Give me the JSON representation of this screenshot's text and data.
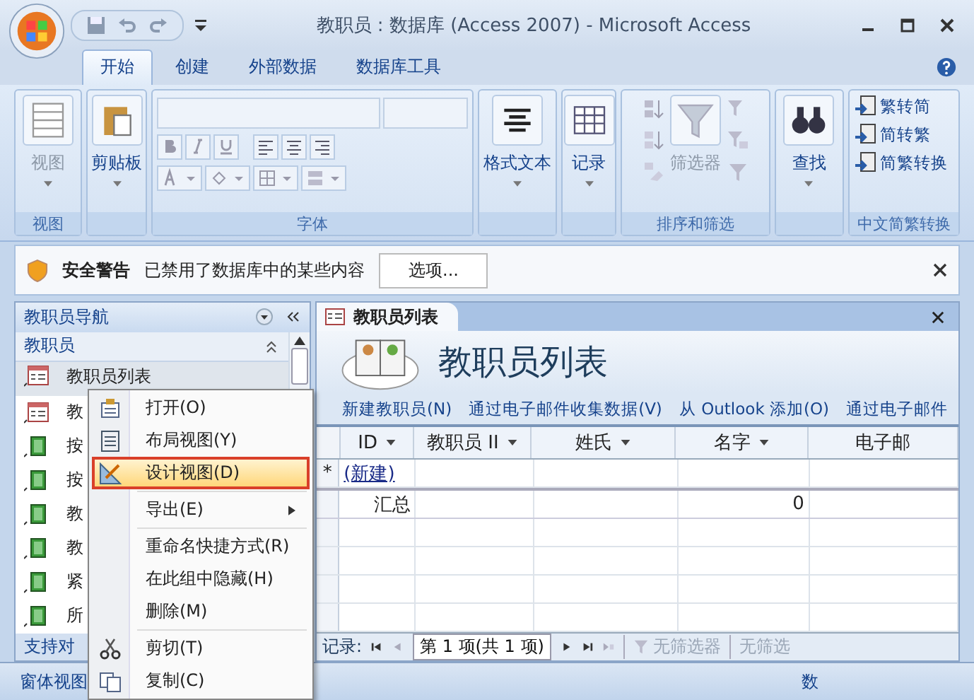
{
  "window": {
    "title": "教职员 : 数据库 (Access 2007) - Microsoft Access"
  },
  "ribbon_tabs": [
    {
      "label": "开始",
      "selected": true
    },
    {
      "label": "创建",
      "selected": false
    },
    {
      "label": "外部数据",
      "selected": false
    },
    {
      "label": "数据库工具",
      "selected": false
    }
  ],
  "ribbon_groups": [
    {
      "kind": "large",
      "button": "视图",
      "disabled": true,
      "footer": "视图"
    },
    {
      "kind": "large",
      "button": "剪贴板",
      "disabled": false
    },
    {
      "kind": "font",
      "footer": "字体"
    },
    {
      "kind": "large",
      "button": "格式文本",
      "disabled": false
    },
    {
      "kind": "large",
      "button": "记录",
      "disabled": false
    },
    {
      "kind": "sort",
      "button": "筛选器",
      "disabled": true,
      "footer": "排序和筛选"
    },
    {
      "kind": "large",
      "button": "查找",
      "disabled": false
    },
    {
      "kind": "list",
      "items": [
        "繁转简",
        "简转繁",
        "简繁转换"
      ],
      "footer": "中文简繁转换"
    }
  ],
  "security_bar": {
    "title": "安全警告",
    "message": "已禁用了数据库中的某些内容",
    "button": "选项..."
  },
  "nav_pane": {
    "title": "教职员导航",
    "group": "教职员",
    "items": [
      {
        "label": "教职员列表",
        "kind": "form-list",
        "selected": true
      },
      {
        "label": "教",
        "kind": "form-list",
        "selected": false
      },
      {
        "label": "按",
        "kind": "report",
        "selected": false
      },
      {
        "label": "按",
        "kind": "report",
        "selected": false
      },
      {
        "label": "教",
        "kind": "report",
        "selected": false
      },
      {
        "label": "教",
        "kind": "report",
        "selected": false
      },
      {
        "label": "紧",
        "kind": "report",
        "selected": false
      },
      {
        "label": "所",
        "kind": "report",
        "selected": false
      }
    ],
    "footer": "支持对"
  },
  "document": {
    "tab": "教职员列表",
    "header": "教职员列表",
    "actions": [
      "新建教职员(N)",
      "通过电子邮件收集数据(V)",
      "从 Outlook 添加(O)",
      "通过电子邮件"
    ],
    "columns": [
      "ID",
      "教职员 II",
      "姓氏",
      "名字",
      "电子邮"
    ],
    "new_row": {
      "marker": "*",
      "label": "(新建)"
    },
    "total_row": {
      "label": "汇总",
      "cells": [
        "",
        "",
        "0",
        ""
      ]
    },
    "record_nav": {
      "label": "记录:",
      "position": "第 1 项(共 1 项)",
      "filter": "无筛选器",
      "search": "无筛选"
    }
  },
  "context_menu": [
    {
      "label": "打开(O)",
      "selected": false
    },
    {
      "label": "布局视图(Y)",
      "selected": false
    },
    {
      "label": "设计视图(D)",
      "selected": true
    },
    {
      "label": "导出(E)",
      "submenu": true,
      "selected": false,
      "separator_before": true
    },
    {
      "label": "重命名快捷方式(R)",
      "selected": false,
      "separator_before": true
    },
    {
      "label": "在此组中隐藏(H)",
      "selected": false
    },
    {
      "label": "删除(M)",
      "selected": false
    },
    {
      "label": "剪切(T)",
      "selected": false,
      "separator_before": true
    },
    {
      "label": "复制(C)",
      "selected": false
    }
  ],
  "status_bar": {
    "view": "窗体视图",
    "right": "数"
  }
}
